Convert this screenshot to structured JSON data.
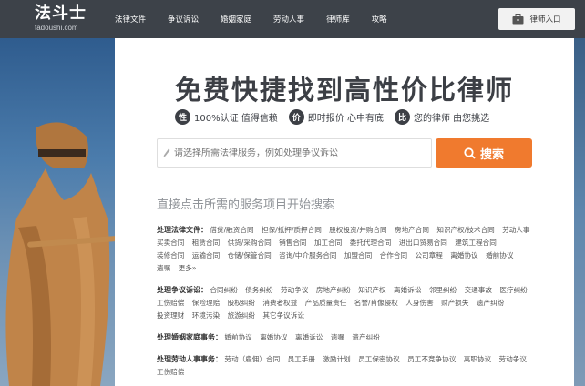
{
  "logo": {
    "main": "法斗士",
    "sub": "fadoushi.com"
  },
  "nav": [
    "法律文件",
    "争议诉讼",
    "婚姻家庭",
    "劳动人事",
    "律师库",
    "攻略"
  ],
  "lawyer_entry": "律师入口",
  "headline": "免费快捷找到高性价比律师",
  "features": [
    {
      "icon": "性",
      "text": "100%认证 值得信赖"
    },
    {
      "icon": "价",
      "text": "即时报价 心中有底"
    },
    {
      "icon": "比",
      "text": "您的律师 由您挑选"
    }
  ],
  "search": {
    "placeholder": "请选择所需法律服务，例如处理争议诉讼",
    "button": "搜索"
  },
  "section_title": "直接点击所需的服务项目开始搜索",
  "categories": [
    {
      "title": "处理法律文件：",
      "links": [
        "借贷/融资合同",
        "担保/抵押/质押合同",
        "股权投资/并购合同",
        "房地产合同",
        "知识产权/技术合同",
        "劳动人事",
        "买卖合同",
        "租赁合同",
        "供货/采购合同",
        "销售合同",
        "加工合同",
        "委托代理合同",
        "进出口贸易合同",
        "建筑工程合同",
        "装修合同",
        "运输合同",
        "仓储/保管合同",
        "咨询/中介服务合同",
        "加盟合同",
        "合作合同",
        "公司章程",
        "离婚协议",
        "婚前协议",
        "遗嘱",
        "更多»"
      ]
    },
    {
      "title": "处理争议诉讼：",
      "links": [
        "合同纠纷",
        "债务纠纷",
        "劳动争议",
        "房地产纠纷",
        "知识产权",
        "离婚诉讼",
        "邻里纠纷",
        "交通事故",
        "医疗纠纷",
        "工伤赔偿",
        "保险理赔",
        "股权纠纷",
        "消费者权益",
        "产品质量责任",
        "名誉/肖像侵权",
        "人身伤害",
        "财产损失",
        "遗产纠纷",
        "投资理财",
        "环境污染",
        "旅游纠纷",
        "其它争议诉讼"
      ]
    },
    {
      "title": "处理婚姻家庭事务：",
      "links": [
        "婚前协议",
        "离婚协议",
        "离婚诉讼",
        "遗嘱",
        "遗产纠纷"
      ]
    },
    {
      "title": "处理劳动人事事务：",
      "links": [
        "劳动（雇佣）合同",
        "员工手册",
        "激励计划",
        "员工保密协议",
        "员工不竞争协议",
        "离职协议",
        "劳动争议",
        "工伤赔偿"
      ]
    }
  ],
  "colors": {
    "header_bg": "#3d4249",
    "accent": "#f07a2e",
    "text_dark": "#3c3f45"
  }
}
